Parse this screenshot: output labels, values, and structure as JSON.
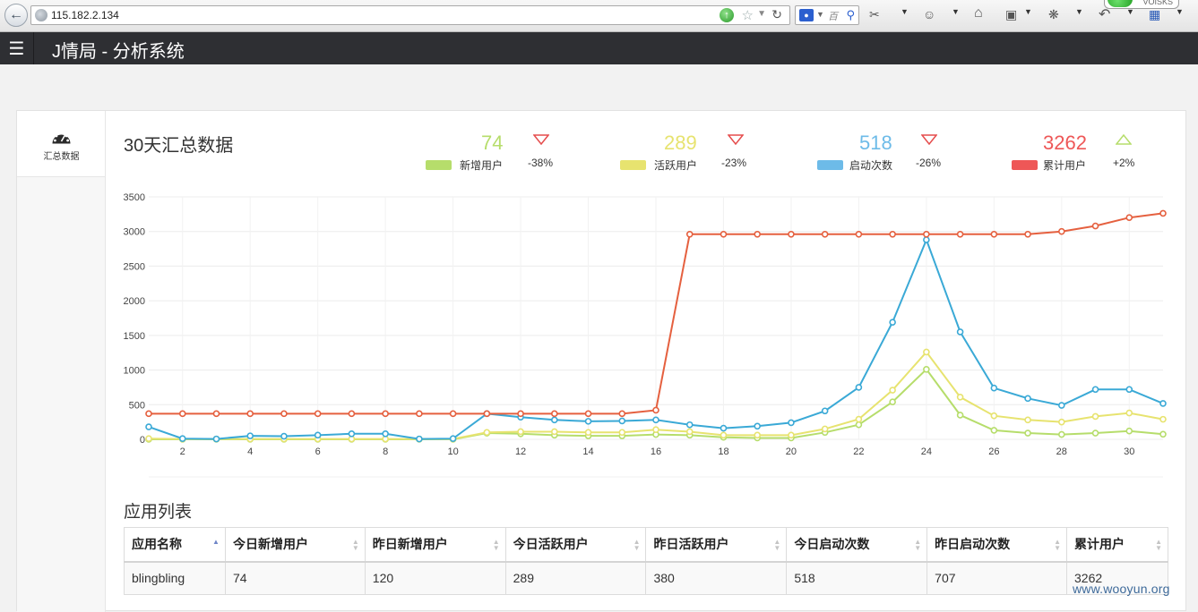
{
  "browser": {
    "url": "115.182.2.134",
    "search_placeholder": "百",
    "addon_text": "VOISKS"
  },
  "app": {
    "title": "J情局 - 分析系统"
  },
  "sidebar": {
    "tab_label": "汇总数据"
  },
  "summary": {
    "title": "30天汇总数据",
    "kpis": [
      {
        "value": "74",
        "label": "新增用户",
        "change": "-38%",
        "trend": "down",
        "color": "#b6dd6b"
      },
      {
        "value": "289",
        "label": "活跃用户",
        "change": "-23%",
        "trend": "down",
        "color": "#e7e36f"
      },
      {
        "value": "518",
        "label": "启动次数",
        "change": "-26%",
        "trend": "down",
        "color": "#6dbbe8"
      },
      {
        "value": "3262",
        "label": "累计用户",
        "change": "+2%",
        "trend": "up",
        "color": "#ee5757"
      }
    ]
  },
  "colors": {
    "new_users": "#b6dd6b",
    "active_users": "#e7e36f",
    "launches": "#3aa9d6",
    "total_users": "#e5603f",
    "down_arrow": "#e54d4d",
    "up_arrow": "#b6dd6b"
  },
  "chart_data": {
    "type": "line",
    "x": [
      1,
      2,
      3,
      4,
      5,
      6,
      7,
      8,
      9,
      10,
      11,
      12,
      13,
      14,
      15,
      16,
      17,
      18,
      19,
      20,
      21,
      22,
      23,
      24,
      25,
      26,
      27,
      28,
      29,
      30,
      31
    ],
    "x_tick_labels": [
      "2",
      "4",
      "6",
      "8",
      "10",
      "12",
      "14",
      "16",
      "18",
      "20",
      "22",
      "24",
      "26",
      "28",
      "30"
    ],
    "y_tick_labels": [
      "0",
      "500",
      "1000",
      "1500",
      "2000",
      "2500",
      "3000",
      "3500"
    ],
    "ylim": [
      0,
      3500
    ],
    "grid": true,
    "series": [
      {
        "name": "累计用户",
        "color": "#e5603f",
        "values": [
          370,
          370,
          370,
          370,
          370,
          370,
          370,
          370,
          370,
          370,
          370,
          370,
          370,
          370,
          370,
          420,
          2960,
          2960,
          2960,
          2960,
          2960,
          2960,
          2960,
          2960,
          2960,
          2960,
          2960,
          3000,
          3080,
          3200,
          3262
        ]
      },
      {
        "name": "启动次数",
        "color": "#3aa9d6",
        "values": [
          180,
          10,
          5,
          50,
          45,
          60,
          80,
          80,
          5,
          10,
          370,
          320,
          280,
          260,
          265,
          280,
          210,
          160,
          190,
          240,
          410,
          750,
          1690,
          2880,
          1550,
          740,
          590,
          490,
          720,
          720,
          518
        ]
      },
      {
        "name": "活跃用户",
        "color": "#e7e36f",
        "values": [
          10,
          5,
          5,
          5,
          5,
          5,
          5,
          5,
          5,
          5,
          100,
          110,
          110,
          100,
          100,
          140,
          110,
          60,
          60,
          60,
          150,
          290,
          710,
          1260,
          610,
          340,
          280,
          250,
          330,
          380,
          289
        ]
      },
      {
        "name": "新增用户",
        "color": "#b6dd6b",
        "values": [
          0,
          0,
          0,
          0,
          0,
          0,
          0,
          0,
          0,
          0,
          90,
          80,
          60,
          50,
          50,
          70,
          60,
          30,
          20,
          20,
          100,
          210,
          540,
          1010,
          350,
          130,
          90,
          70,
          90,
          120,
          74
        ]
      }
    ]
  },
  "app_list": {
    "title": "应用列表",
    "columns": [
      "应用名称",
      "今日新增用户",
      "昨日新增用户",
      "今日活跃用户",
      "昨日活跃用户",
      "今日启动次数",
      "昨日启动次数",
      "累计用户"
    ],
    "rows": [
      [
        "blingbling",
        "74",
        "120",
        "289",
        "380",
        "518",
        "707",
        "3262"
      ]
    ]
  },
  "watermark": "www.wooyun.org"
}
